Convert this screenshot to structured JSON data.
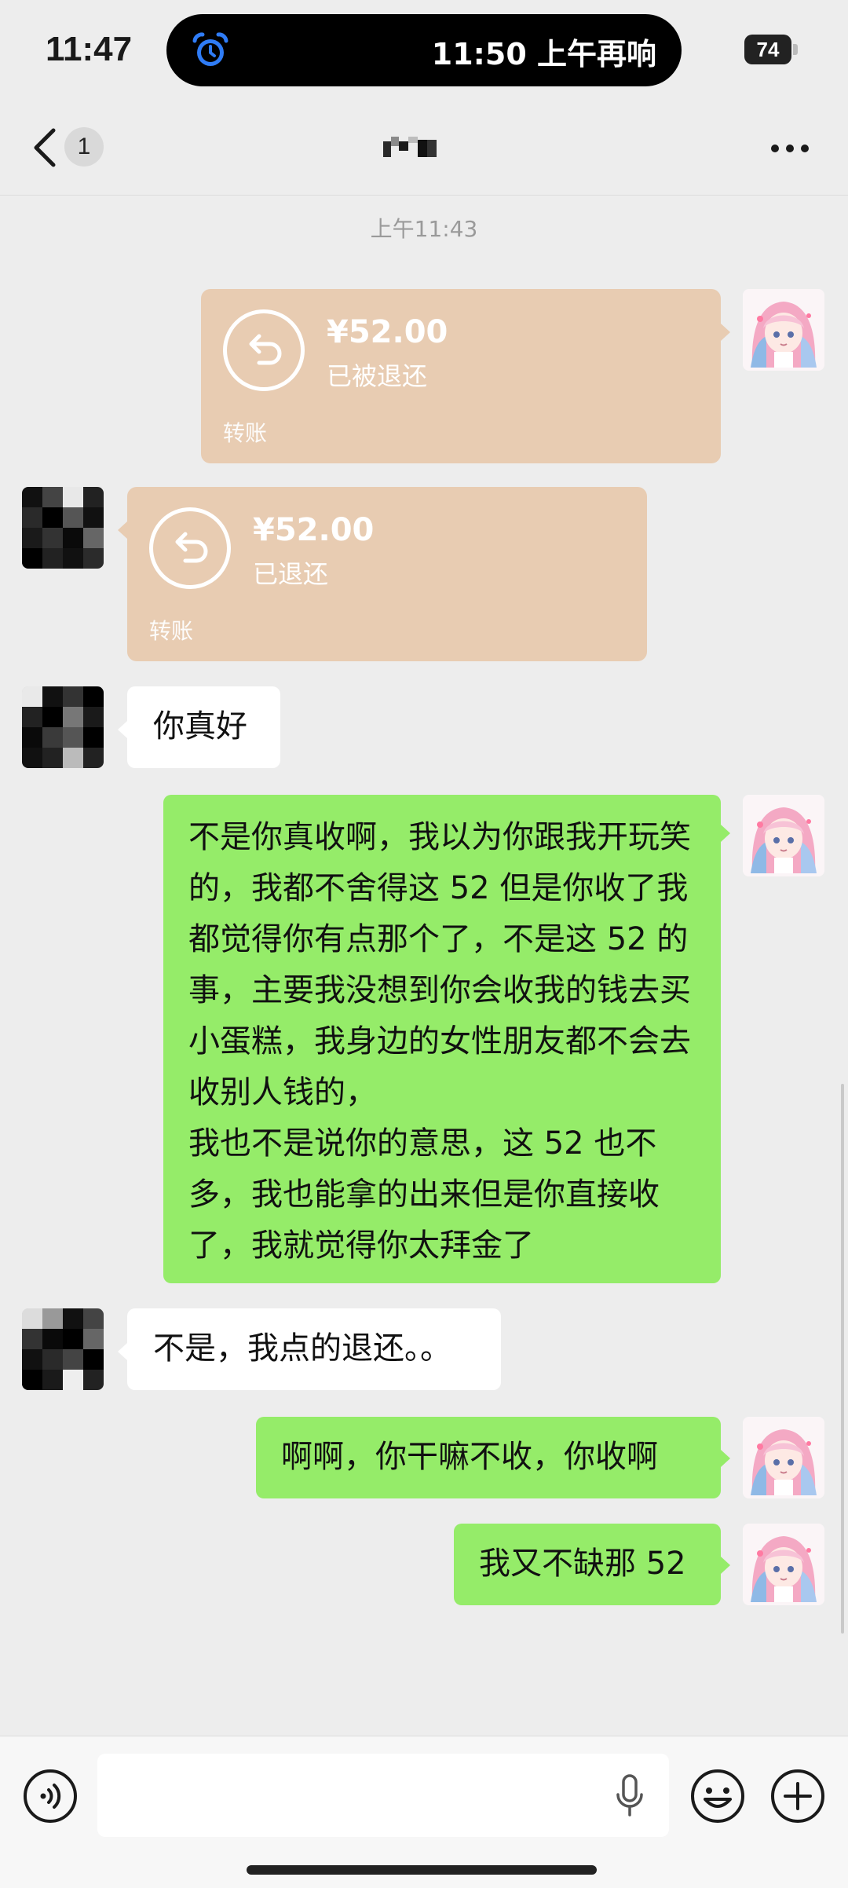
{
  "status_bar": {
    "time": "11:47",
    "alarm_text": "11:50 上午再响",
    "battery": "74"
  },
  "nav": {
    "unread_badge": "1"
  },
  "timestamp": "上午11:43",
  "transfers": [
    {
      "amount": "¥52.00",
      "status": "已被退还",
      "label": "转账"
    },
    {
      "amount": "¥52.00",
      "status": "已退还",
      "label": "转账"
    }
  ],
  "messages": {
    "peer_1": "你真好",
    "mine_long": "不是你真收啊，我以为你跟我开玩笑的，我都不舍得这 52 但是你收了我都觉得你有点那个了，不是这 52 的事，主要我没想到你会收我的钱去买小蛋糕，我身边的女性朋友都不会去收别人钱的，\n我也不是说你的意思，这 52 也不多，我也能拿的出来但是你直接收了，我就觉得你太拜金了",
    "peer_2": "不是，我点的退还。。",
    "mine_2": "啊啊，你干嘛不收，你收啊",
    "mine_3": "我又不缺那 52"
  },
  "colors": {
    "background": "#ededed",
    "my_bubble": "#95ec69",
    "peer_bubble": "#ffffff",
    "transfer_card": "#e8ccb2",
    "alarm_icon": "#2f7cf6"
  },
  "icons": [
    "back-chevron-icon",
    "more-icon",
    "alarm-clock-icon",
    "return-arrow-icon",
    "voice-icon",
    "microphone-icon",
    "emoji-icon",
    "plus-icon"
  ]
}
